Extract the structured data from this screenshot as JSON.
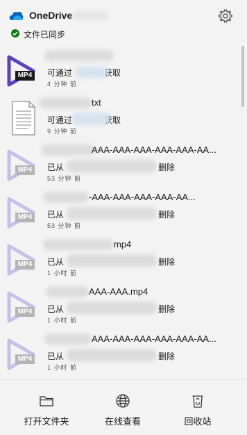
{
  "header": {
    "app_title": "OneDrive",
    "sync_status": "文件已同步"
  },
  "files": [
    {
      "name": "",
      "status": "可通过",
      "status_tail": "获取",
      "time": "4 分钟 前",
      "badge": "MP4",
      "type": "video",
      "active": true
    },
    {
      "name": "txt",
      "status": "可通过",
      "status_tail": "获取",
      "time": "9 分钟 前",
      "badge": "",
      "type": "text",
      "active": true
    },
    {
      "name": "AAA-AAA-AAA-AAA-AAA-AA...",
      "status": "已从",
      "status_tail": "删除",
      "time": "53 分钟 前",
      "badge": "MP4",
      "type": "video",
      "active": false
    },
    {
      "name": "-AAA-AAA-AAA-AAA-AA...",
      "status": "已从",
      "status_tail": "删除",
      "time": "53 分钟 前",
      "badge": "MP4",
      "type": "video",
      "active": false
    },
    {
      "name": "mp4",
      "status": "已从",
      "status_tail": "删除",
      "time": "1 小时 前",
      "badge": "MP4",
      "type": "video",
      "active": false
    },
    {
      "name": "AAA-AAA.mp4",
      "status": "已从",
      "status_tail": "删除",
      "time": "1 小时 前",
      "badge": "MP4",
      "type": "video",
      "active": false
    },
    {
      "name": "AAA-AAA-AAA-AAA-AAA-AA...",
      "status": "已从",
      "status_tail": "删除",
      "time": "1 小时 前",
      "badge": "MP4",
      "type": "video",
      "active": false
    }
  ],
  "footer": {
    "open_folder": "打开文件夹",
    "view_online": "在线查看",
    "recycle_bin": "回收站"
  },
  "colors": {
    "accent_purple": "#5e3fbe",
    "faded_purple": "#c8bfe8",
    "sync_green": "#107c10",
    "onedrive_blue": "#0364b8"
  },
  "icons": [
    "onedrive-cloud-icon",
    "gear-icon",
    "check-icon",
    "video-file-icon",
    "text-file-icon",
    "folder-icon",
    "globe-icon",
    "recycle-bin-icon"
  ]
}
